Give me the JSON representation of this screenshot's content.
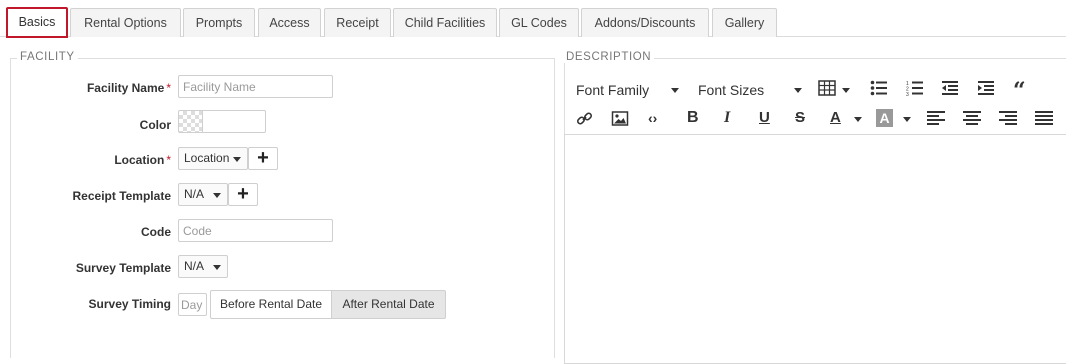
{
  "tabs": [
    {
      "label": "Basics",
      "active": true
    },
    {
      "label": "Rental Options"
    },
    {
      "label": "Prompts"
    },
    {
      "label": "Access"
    },
    {
      "label": "Receipt"
    },
    {
      "label": "Child Facilities"
    },
    {
      "label": "GL Codes"
    },
    {
      "label": "Addons/Discounts"
    },
    {
      "label": "Gallery"
    }
  ],
  "facility": {
    "legend": "FACILITY",
    "name_label": "Facility Name",
    "name_placeholder": "Facility Name",
    "required_mark": "*",
    "color_label": "Color",
    "location_label": "Location",
    "location_value": "Location",
    "receipt_label": "Receipt Template",
    "receipt_value": "N/A",
    "code_label": "Code",
    "code_placeholder": "Code",
    "survey_label": "Survey Template",
    "survey_value": "N/A",
    "timing_label": "Survey Timing",
    "timing_placeholder": "Day",
    "timing_options": [
      "Before Rental Date",
      "After Rental Date"
    ],
    "timing_selected": "After Rental Date"
  },
  "description": {
    "legend": "DESCRIPTION",
    "font_family": "Font Family",
    "font_sizes": "Font Sizes",
    "toolbar_icons": [
      "table-icon",
      "unordered-list-icon",
      "ordered-list-icon",
      "outdent-icon",
      "indent-icon",
      "blockquote-icon",
      "link-icon",
      "image-icon",
      "code-icon",
      "bold-icon",
      "italic-icon",
      "underline-icon",
      "strikethrough-icon",
      "font-color-icon",
      "highlight-color-icon",
      "align-left-icon",
      "align-center-icon",
      "align-right-icon",
      "justify-icon"
    ]
  }
}
